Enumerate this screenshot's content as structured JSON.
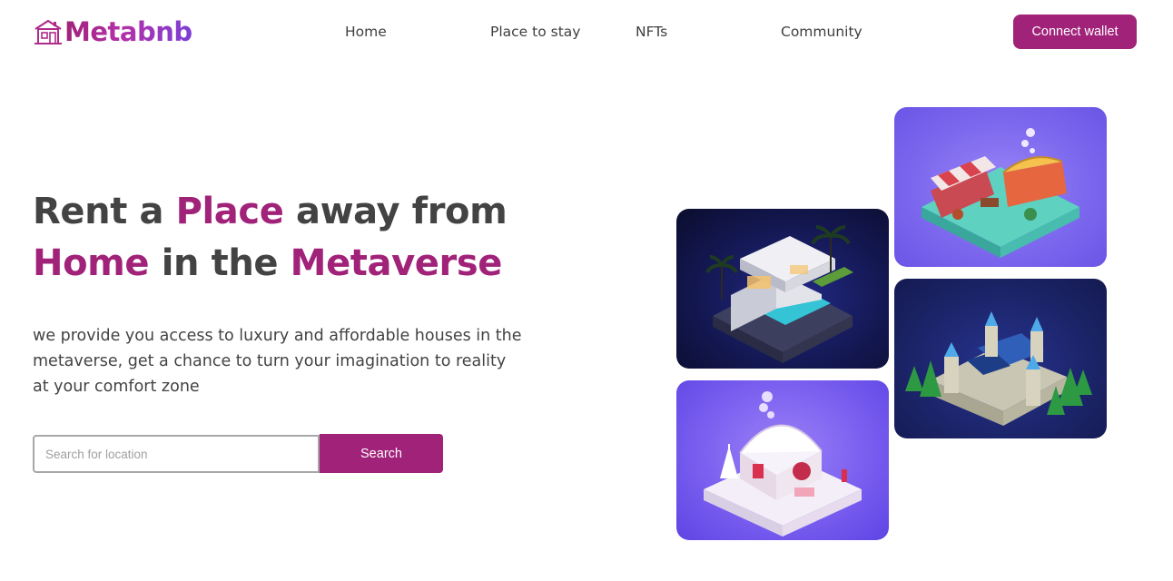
{
  "brand": {
    "name": "Metabnb",
    "gradient": [
      "#a02279",
      "#7a3fd8"
    ],
    "icon": "house-icon"
  },
  "nav": {
    "items": [
      {
        "label": "Home"
      },
      {
        "label": "Place to stay"
      },
      {
        "label": "NFTs"
      },
      {
        "label": "Community"
      }
    ],
    "connect_label": "Connect wallet"
  },
  "hero": {
    "title": {
      "part1": "Rent a ",
      "accent1": "Place",
      "part2": " away from",
      "accent2": "Home",
      "part3": " in the ",
      "accent3": "Metaverse"
    },
    "description": "we provide you access to luxury and affordable houses in the metaverse, get a chance to turn your imagination to reality at your comfort zone",
    "search": {
      "placeholder": "Search for location",
      "value": "",
      "button_label": "Search"
    }
  },
  "gallery": {
    "images": [
      {
        "subject": "isometric-modern-villa-night"
      },
      {
        "subject": "isometric-market-stall"
      },
      {
        "subject": "isometric-castle-fortress"
      },
      {
        "subject": "isometric-winter-cottage"
      }
    ]
  },
  "colors": {
    "accent": "#a02279",
    "text": "#434343",
    "background": "#ffffff"
  }
}
